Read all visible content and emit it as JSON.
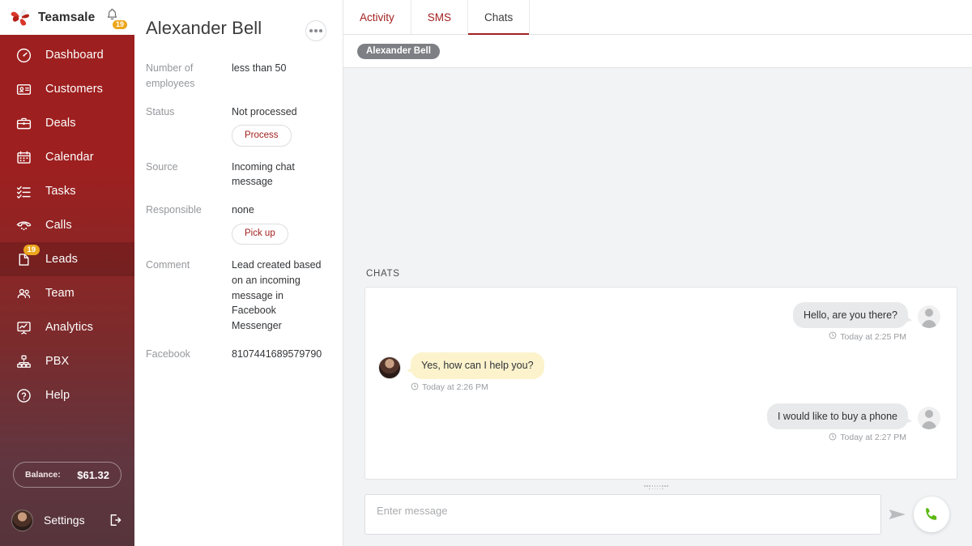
{
  "sidebar": {
    "brand": "Teamsale",
    "logo_icon": "pinwheel-logo-icon",
    "notification_icon": "bell-icon",
    "notification_count": "19",
    "items": [
      {
        "label": "Dashboard",
        "icon": "speedometer-icon",
        "badge": "",
        "active": false
      },
      {
        "label": "Customers",
        "icon": "contact-card-icon",
        "badge": "",
        "active": false
      },
      {
        "label": "Deals",
        "icon": "briefcase-icon",
        "badge": "",
        "active": false
      },
      {
        "label": "Calendar",
        "icon": "calendar-icon",
        "badge": "",
        "active": false
      },
      {
        "label": "Tasks",
        "icon": "checklist-icon",
        "badge": "",
        "active": false
      },
      {
        "label": "Calls",
        "icon": "phone-handset-icon",
        "badge": "",
        "active": false
      },
      {
        "label": "Leads",
        "icon": "lead-document-icon",
        "badge": "19",
        "active": true
      },
      {
        "label": "Team",
        "icon": "people-icon",
        "badge": "",
        "active": false
      },
      {
        "label": "Analytics",
        "icon": "chart-board-icon",
        "badge": "",
        "active": false
      },
      {
        "label": "PBX",
        "icon": "network-tree-icon",
        "badge": "",
        "active": false
      },
      {
        "label": "Help",
        "icon": "question-circle-icon",
        "badge": "",
        "active": false
      }
    ],
    "balance_label": "Balance:",
    "balance_value": "$61.32",
    "settings_label": "Settings",
    "settings_avatar_icon": "user-avatar",
    "logout_icon": "logout-icon",
    "accent": "#9e1f1f",
    "badge_color": "#eda61d"
  },
  "lead": {
    "title": "Alexander Bell",
    "menu_icon": "more-options-icon",
    "fields": [
      {
        "label": "Number of employees",
        "value": "less than 50",
        "action": ""
      },
      {
        "label": "Status",
        "value": "Not processed",
        "action": "Process"
      },
      {
        "label": "Source",
        "value": "Incoming chat message",
        "action": ""
      },
      {
        "label": "Responsible",
        "value": "none",
        "action": "Pick up"
      },
      {
        "label": "Comment",
        "value": "Lead created based on an incoming message in Facebook Messenger",
        "action": ""
      },
      {
        "label": "Facebook",
        "value": "8107441689579790",
        "action": ""
      }
    ]
  },
  "chat": {
    "tabs": [
      {
        "label": "Activity",
        "active": false
      },
      {
        "label": "SMS",
        "active": false
      },
      {
        "label": "Chats",
        "active": true
      }
    ],
    "contact_chip": "Alexander Bell",
    "section_label": "CHATS",
    "messages": [
      {
        "text": "Hello, are you there?",
        "time": "Today at 2:25 PM",
        "direction": "incoming",
        "avatar": "generic-person-avatar",
        "bubble_color": "#e8e9eb"
      },
      {
        "text": "Yes, how can I help you?",
        "time": "Today at 2:26 PM",
        "direction": "outgoing",
        "avatar": "agent-photo-avatar",
        "bubble_color": "#fcf3cd"
      },
      {
        "text": "I would like to buy a phone",
        "time": "Today at 2:27 PM",
        "direction": "incoming",
        "avatar": "generic-person-avatar",
        "bubble_color": "#e8e9eb"
      }
    ],
    "composer_placeholder": "Enter message",
    "composer_value": "",
    "send_icon": "send-paper-plane-icon",
    "call_icon": "phone-call-icon",
    "call_icon_color": "#5cb811",
    "resize_handle_icon": "drag-grip-icon",
    "clock_icon": "clock-icon"
  }
}
